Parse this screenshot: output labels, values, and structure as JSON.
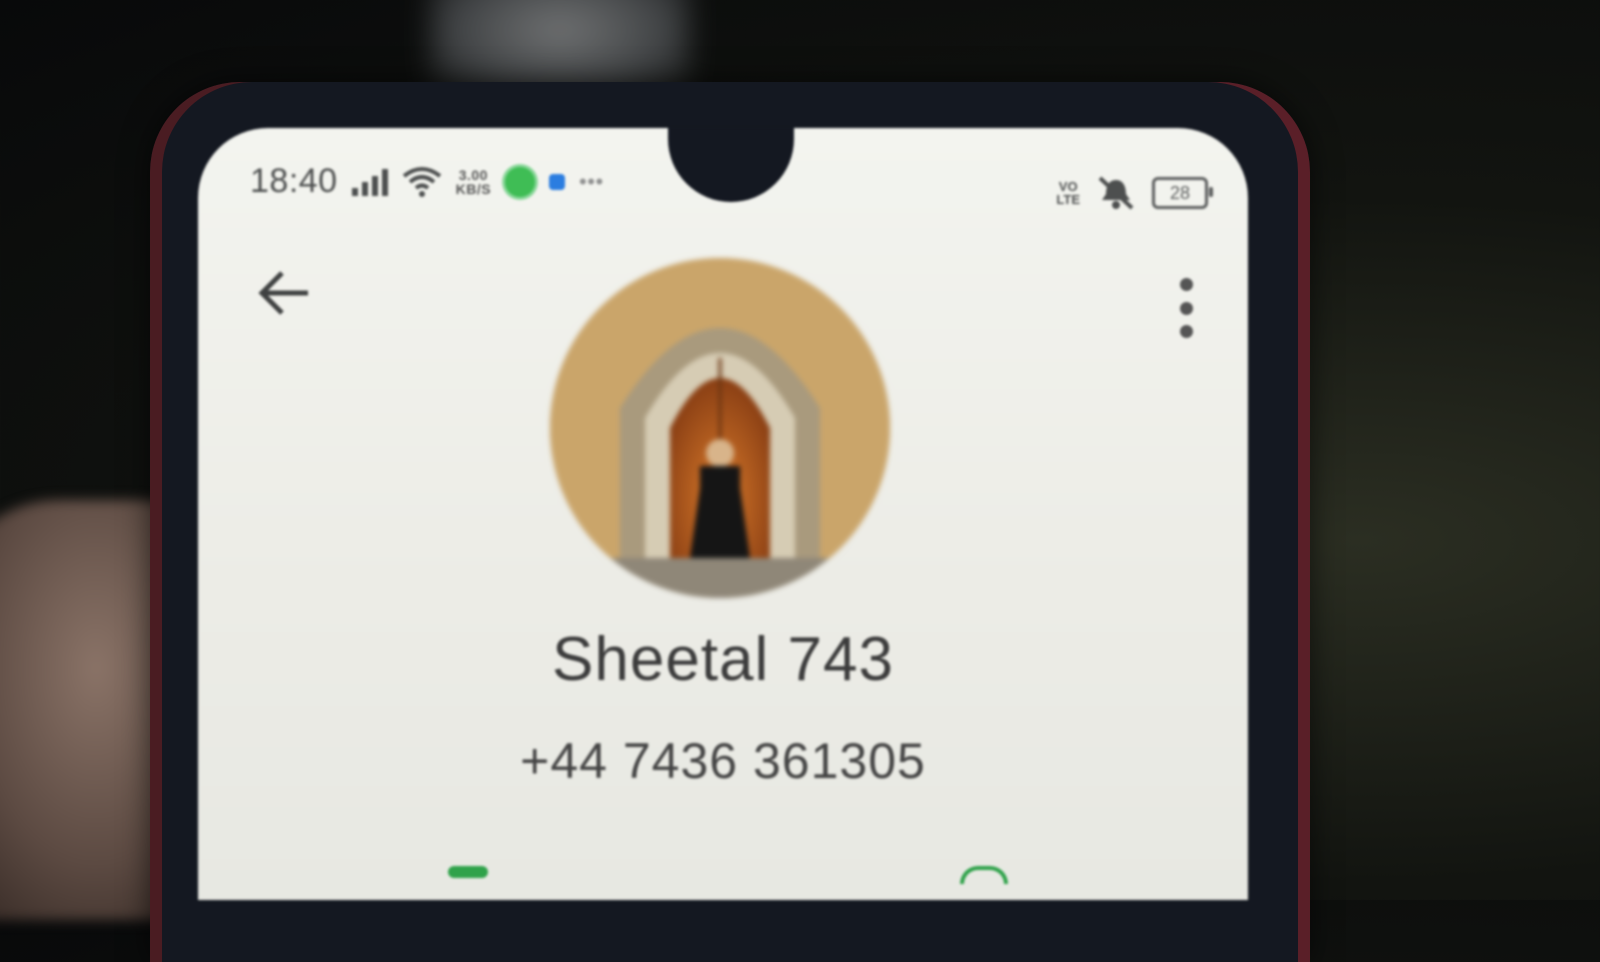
{
  "status_bar": {
    "time": "18:40",
    "net_speed_value": "3.00",
    "net_speed_unit": "KB/S",
    "volte_top": "VO",
    "volte_bottom": "LTE",
    "battery": "28"
  },
  "contact": {
    "name": "Sheetal 743",
    "phone": "+44 7436 361305"
  },
  "icons": {
    "back": "arrow-left-icon",
    "menu": "more-vert-icon",
    "wifi": "wifi-icon",
    "signal": "signal-icon",
    "mute": "vibrate-off-icon"
  },
  "colors": {
    "screen_bg": "#ecece6",
    "accent_green": "#3fbd55"
  }
}
